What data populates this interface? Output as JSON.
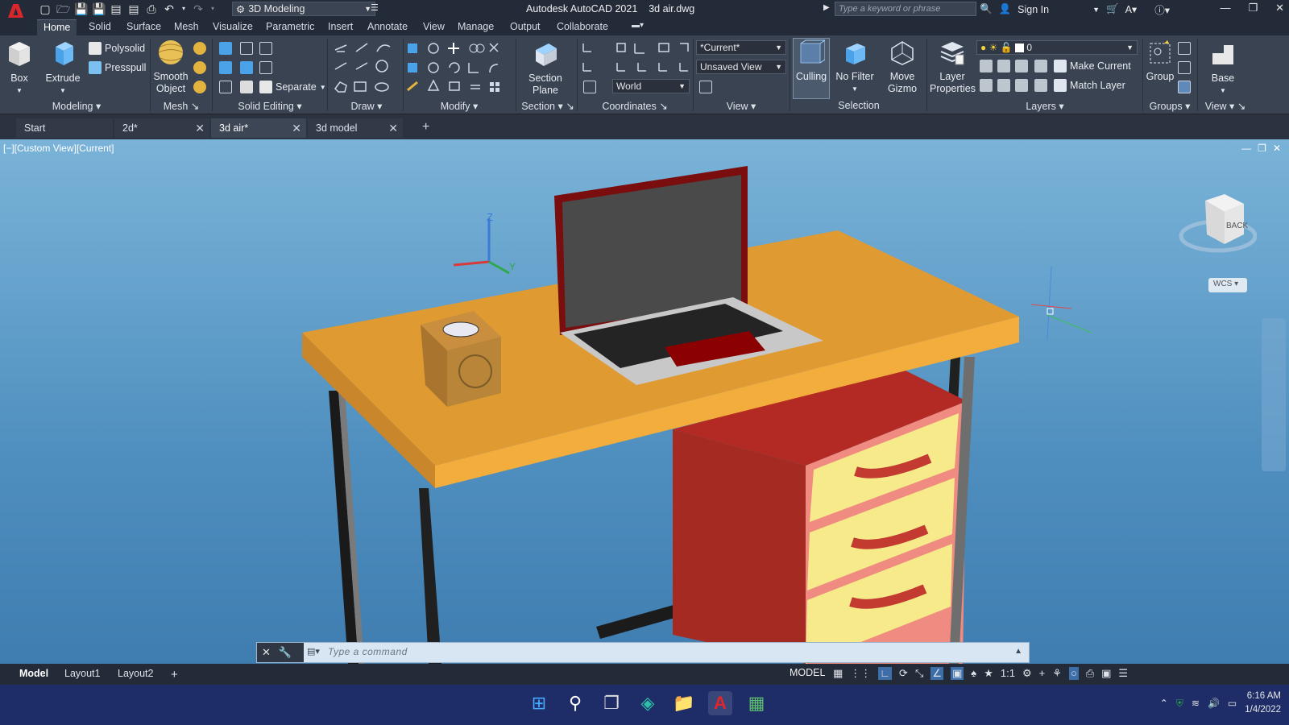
{
  "app": {
    "title": "Autodesk AutoCAD 2021",
    "file": "3d air.dwg",
    "workspace": "3D Modeling",
    "search_placeholder": "Type a keyword or phrase",
    "sign_in": "Sign In"
  },
  "ribbon_tabs": [
    "Home",
    "Solid",
    "Surface",
    "Mesh",
    "Visualize",
    "Parametric",
    "Insert",
    "Annotate",
    "View",
    "Manage",
    "Output",
    "Collaborate"
  ],
  "ribbon": {
    "modeling": {
      "title": "Modeling",
      "box": "Box",
      "extrude": "Extrude",
      "polysolid": "Polysolid",
      "presspull": "Presspull"
    },
    "mesh": {
      "title": "Mesh",
      "smooth_object": "Smooth Object"
    },
    "solid_editing": {
      "title": "Solid Editing",
      "separate": "Separate"
    },
    "draw": {
      "title": "Draw"
    },
    "modify": {
      "title": "Modify"
    },
    "section": {
      "title": "Section",
      "section_plane": "Section Plane"
    },
    "coordinates": {
      "title": "Coordinates",
      "ucs": "World"
    },
    "view": {
      "title": "View",
      "visual_style": "*Current*",
      "named_view": "Unsaved View"
    },
    "selection": {
      "title": "Selection",
      "culling": "Culling",
      "no_filter": "No Filter",
      "move_gizmo": "Move Gizmo"
    },
    "layers": {
      "title": "Layers",
      "layer_properties": "Layer Properties",
      "current_layer": "0",
      "make_current": "Make Current",
      "match_layer": "Match Layer"
    },
    "groups": {
      "title": "Groups",
      "group": "Group"
    },
    "view2": {
      "title": "View",
      "base": "Base"
    }
  },
  "file_tabs": [
    {
      "label": "Start"
    },
    {
      "label": "2d*"
    },
    {
      "label": "3d air*"
    },
    {
      "label": "3d model"
    }
  ],
  "viewport": {
    "label": "[−][Custom View][Current]",
    "viewcube_face": "BACK",
    "wcs": "WCS",
    "axis_z": "Z",
    "axis_y": "Y"
  },
  "command": {
    "placeholder": "Type a command"
  },
  "layout_tabs": [
    "Model",
    "Layout1",
    "Layout2"
  ],
  "status": {
    "space": "MODEL",
    "scale": "1:1"
  },
  "clock": {
    "time": "6:16 AM",
    "date": "1/4/2022"
  }
}
